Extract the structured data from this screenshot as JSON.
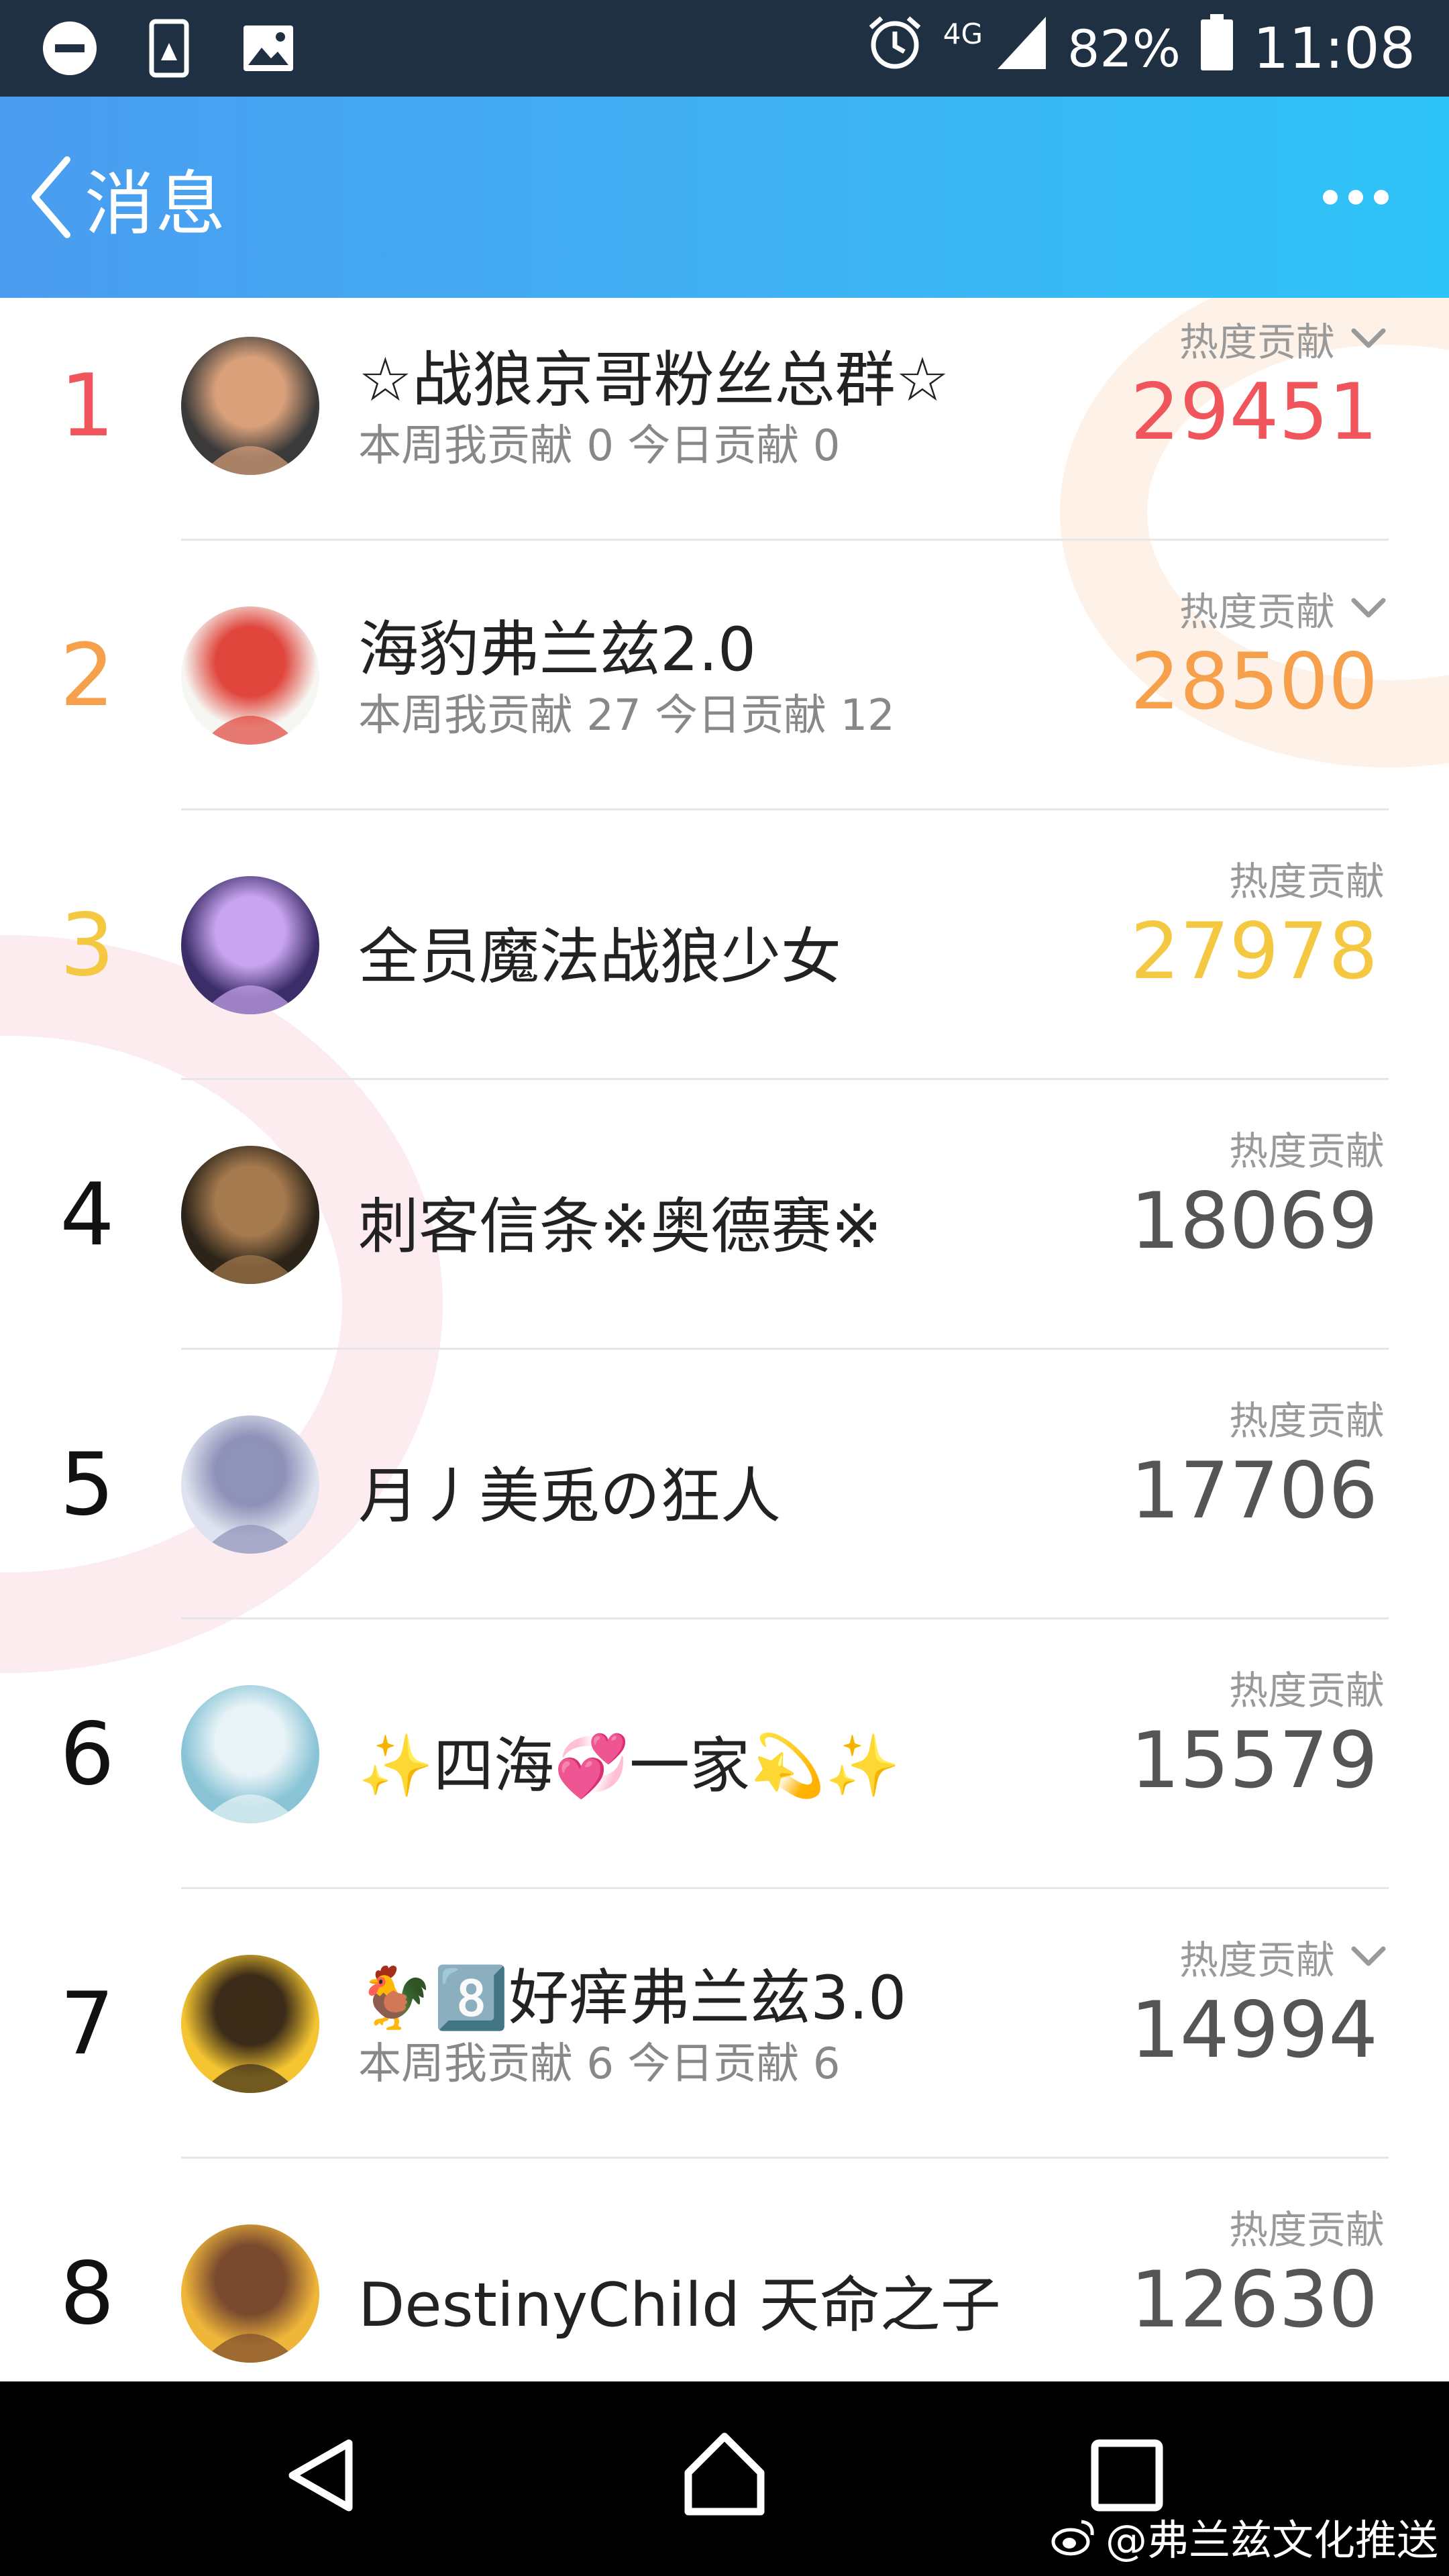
{
  "status_bar": {
    "network": "4G",
    "battery": "82%",
    "time": "11:08"
  },
  "header": {
    "back_label": "消息"
  },
  "groups": [
    {
      "rank": "1",
      "name": "☆战狼京哥粉丝总群☆",
      "sub": "本周我贡献 0  今日贡献 0",
      "heat_label": "热度贡献",
      "heat_value": "29451",
      "rank_color": "#f0555b",
      "value_color": "#f0555b",
      "avatar_icon": "thumbs-up-man-avatar"
    },
    {
      "rank": "2",
      "name": "海豹弗兰兹2.0",
      "sub": "本周我贡献 27  今日贡献 12",
      "heat_label": "热度贡献",
      "heat_value": "28500",
      "rank_color": "#f7a04b",
      "value_color": "#f7a04b",
      "avatar_icon": "seal-helmet-avatar"
    },
    {
      "rank": "3",
      "name": "全员魔法战狼少女",
      "sub": "",
      "heat_label": "热度贡献",
      "heat_value": "27978",
      "rank_color": "#f5c842",
      "value_color": "#f5c842",
      "avatar_icon": "anime-girls-avatar"
    },
    {
      "rank": "4",
      "name": "刺客信条※奥德赛※",
      "sub": "",
      "heat_label": "热度贡献",
      "heat_value": "18069",
      "rank_color": "#111111",
      "value_color": "#555555",
      "avatar_icon": "spartan-warrior-avatar"
    },
    {
      "rank": "5",
      "name": "月丿美兎の狂人",
      "sub": "",
      "heat_label": "热度贡献",
      "heat_value": "17706",
      "rank_color": "#111111",
      "value_color": "#555555",
      "avatar_icon": "silver-hair-girl-avatar"
    },
    {
      "rank": "6",
      "name": "✨四海💞一家💫✨",
      "sub": "",
      "heat_label": "热度贡献",
      "heat_value": "15579",
      "rank_color": "#111111",
      "value_color": "#555555",
      "avatar_icon": "hands-water-avatar"
    },
    {
      "rank": "7",
      "name": "🐓8️⃣好痒弗兰兹3.0",
      "sub": "本周我贡献 6  今日贡献 6",
      "heat_label": "热度贡献",
      "heat_value": "14994",
      "rank_color": "#111111",
      "value_color": "#555555",
      "avatar_icon": "pop-team-epic-avatar"
    },
    {
      "rank": "8",
      "name": "DestinyChild 天命之子",
      "sub": "",
      "heat_label": "热度贡献",
      "heat_value": "12630",
      "rank_color": "#111111",
      "value_color": "#555555",
      "avatar_icon": "destiny-child-avatar"
    }
  ],
  "watermark": "@弗兰兹文化推送"
}
